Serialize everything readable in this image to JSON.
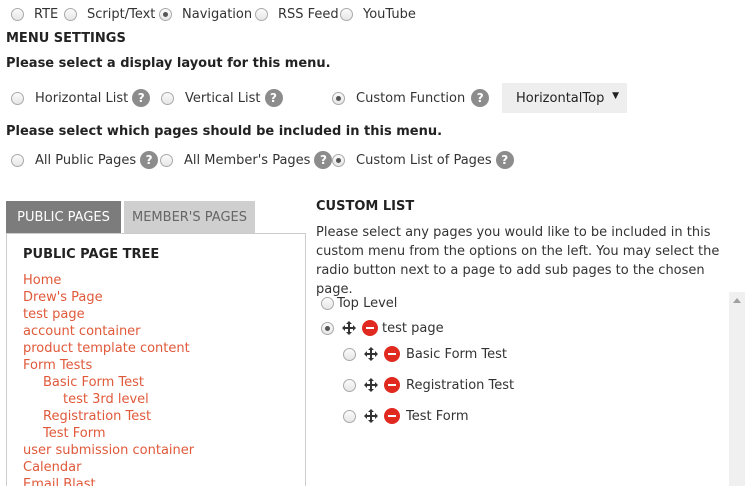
{
  "content_types": [
    {
      "label": "RTE",
      "checked": false
    },
    {
      "label": "Script/Text",
      "checked": false
    },
    {
      "label": "Navigation",
      "checked": true
    },
    {
      "label": "RSS Feed",
      "checked": false
    },
    {
      "label": "YouTube",
      "checked": false
    }
  ],
  "menu_settings": {
    "title": "MENU SETTINGS",
    "layout_prompt": "Please select a display layout for this menu.",
    "layouts": [
      {
        "label": "Horizontal List",
        "checked": false
      },
      {
        "label": "Vertical List",
        "checked": false
      },
      {
        "label": "Custom Function",
        "checked": true
      }
    ],
    "function_select": "HorizontalTop",
    "pages_prompt": "Please select which pages should be included in this menu.",
    "page_scopes": [
      {
        "label": "All Public Pages",
        "checked": false
      },
      {
        "label": "All Member's Pages",
        "checked": false
      },
      {
        "label": "Custom List of Pages",
        "checked": true
      }
    ],
    "help_glyph": "?"
  },
  "tabs": {
    "public": "PUBLIC PAGES",
    "members": "MEMBER'S PAGES"
  },
  "tree": {
    "title": "PUBLIC PAGE TREE",
    "items": [
      {
        "label": "Home",
        "level": 0
      },
      {
        "label": "Drew's Page",
        "level": 0
      },
      {
        "label": "test page",
        "level": 0
      },
      {
        "label": "account container",
        "level": 0
      },
      {
        "label": "product template content",
        "level": 0
      },
      {
        "label": "Form Tests",
        "level": 0
      },
      {
        "label": "Basic Form Test",
        "level": 1
      },
      {
        "label": "test 3rd level",
        "level": 2
      },
      {
        "label": "Registration Test",
        "level": 1
      },
      {
        "label": "Test Form",
        "level": 1
      },
      {
        "label": "user submission container",
        "level": 0
      },
      {
        "label": "Calendar",
        "level": 0
      },
      {
        "label": "Email Blast",
        "level": 0
      }
    ]
  },
  "custom_list": {
    "title": "CUSTOM LIST",
    "description": "Please select any pages you would like to be included in this custom menu from the options on the left. You may select the radio button next to a page to add sub pages to the chosen page.",
    "top_level": "Top Level",
    "root": {
      "label": "test page",
      "checked": true
    },
    "children": [
      {
        "label": "Basic Form Test"
      },
      {
        "label": "Registration Test"
      },
      {
        "label": "Test Form"
      }
    ]
  },
  "icons": {
    "move": "move-icon",
    "remove": "remove-icon",
    "help": "help-icon",
    "dropdown": "chevron-down-icon"
  },
  "colors": {
    "link": "#e0593a",
    "remove": "#e02a1f",
    "tab_active": "#7c7c7c",
    "tab_inactive": "#cfcfcf"
  }
}
